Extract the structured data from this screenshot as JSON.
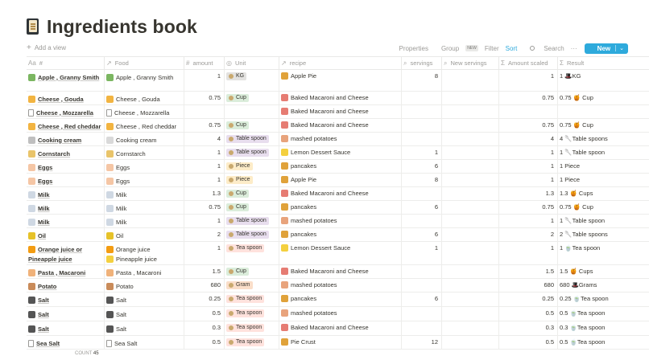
{
  "page": {
    "title": "Ingredients book",
    "icon": "book-icon"
  },
  "toolbar": {
    "add_view": "Add a view",
    "properties": "Properties",
    "group": "Group",
    "group_badge": "NEW",
    "filter": "Filter",
    "sort": "Sort",
    "search": "Search",
    "more": "···",
    "new": "New",
    "new_caret": "⌄"
  },
  "columns": [
    {
      "label": "#",
      "icon": "Aa"
    },
    {
      "label": "Food",
      "icon": "↗"
    },
    {
      "label": "amount",
      "icon": "#"
    },
    {
      "label": "Unit",
      "icon": "◎"
    },
    {
      "label": "recipe",
      "icon": "↗"
    },
    {
      "label": "servings",
      "icon": "⌕"
    },
    {
      "label": "New servings",
      "icon": "⌕"
    },
    {
      "label": "Amount scaled",
      "icon": "Σ"
    },
    {
      "label": "Result",
      "icon": "Σ"
    }
  ],
  "tag_colors": {
    "KG": "#e3e2e0",
    "Cup": "#dbeddb",
    "Table spoon": "#e8deee",
    "Piece": "#fdecc8",
    "Tea spoon": "#ffe2dd",
    "Gram": "#fadec9"
  },
  "rows": [
    {
      "name": [
        "Apple , Granny Smith"
      ],
      "icon": "#7bb661",
      "food": [
        "Apple , Granny Smith"
      ],
      "food_icon": "#7bb661",
      "amount": "1",
      "unit": "KG",
      "recipe": "Apple Pie",
      "recipe_icon": "#e0a23a",
      "servings": "8",
      "new_servings": "",
      "scaled": "1",
      "result": "1 🎩KG",
      "h": 27
    },
    {
      "name": [
        "Cheese , Gouda"
      ],
      "icon": "#f2b441",
      "food": [
        "Cheese , Gouda"
      ],
      "food_icon": "#f2b441",
      "amount": "0.75",
      "unit": "Cup",
      "recipe": "Baked Macaroni and Cheese",
      "recipe_icon": "#e67c73",
      "servings": "",
      "new_servings": "",
      "scaled": "0.75",
      "result": "0.75 🍯 Cup",
      "h": 17
    },
    {
      "name": [
        "Cheese , Mozzarella"
      ],
      "icon": "page",
      "food": [
        "Cheese , Mozzarella"
      ],
      "food_icon": "page",
      "amount": "",
      "unit": "",
      "recipe": "Baked Macaroni and Cheese",
      "recipe_icon": "#e67c73",
      "servings": "",
      "new_servings": "",
      "scaled": "",
      "result": "",
      "h": 17
    },
    {
      "name": [
        "Cheese , Red cheddar"
      ],
      "icon": "#f2b441",
      "food": [
        "Cheese , Red cheddar"
      ],
      "food_icon": "#f2b441",
      "amount": "0.75",
      "unit": "Cup",
      "recipe": "Baked Macaroni and Cheese",
      "recipe_icon": "#e67c73",
      "servings": "",
      "new_servings": "",
      "scaled": "0.75",
      "result": "0.75 🍯 Cup",
      "h": 17
    },
    {
      "name": [
        "Cooking cream"
      ],
      "icon": "#bfbfbf",
      "food": [
        "Cooking cream"
      ],
      "food_icon": "#d9d9d9",
      "amount": "4",
      "unit": "Table spoon",
      "recipe": "mashed potatoes",
      "recipe_icon": "#e8a37c",
      "servings": "",
      "new_servings": "",
      "scaled": "4",
      "result": "4 🥄Table spoons",
      "h": 17
    },
    {
      "name": [
        "Cornstarch"
      ],
      "icon": "#e9c46a",
      "food": [
        "Cornstarch"
      ],
      "food_icon": "#e9c46a",
      "amount": "1",
      "unit": "Table spoon",
      "recipe": "Lemon Dessert Sauce",
      "recipe_icon": "#f4d03f",
      "servings": "1",
      "new_servings": "",
      "scaled": "1",
      "result": "1 🥄Table spoon",
      "h": 17
    },
    {
      "name": [
        "Eggs"
      ],
      "icon": "#f5c6a5",
      "food": [
        "Eggs"
      ],
      "food_icon": "#f5c6a5",
      "amount": "1",
      "unit": "Piece",
      "recipe": "pancakes",
      "recipe_icon": "#e0a23a",
      "servings": "6",
      "new_servings": "",
      "scaled": "1",
      "result": "1 Piece",
      "h": 17
    },
    {
      "name": [
        "Eggs"
      ],
      "icon": "#f5c6a5",
      "food": [
        "Eggs"
      ],
      "food_icon": "#f5c6a5",
      "amount": "1",
      "unit": "Piece",
      "recipe": "Apple Pie",
      "recipe_icon": "#e0a23a",
      "servings": "8",
      "new_servings": "",
      "scaled": "1",
      "result": "1 Piece",
      "h": 17
    },
    {
      "name": [
        "Milk"
      ],
      "icon": "#cfd8e3",
      "food": [
        "Milk"
      ],
      "food_icon": "#cfd8e3",
      "amount": "1.3",
      "unit": "Cup",
      "recipe": "Baked Macaroni and Cheese",
      "recipe_icon": "#e67c73",
      "servings": "",
      "new_servings": "",
      "scaled": "1.3",
      "result": "1.3 🍯 Cups",
      "h": 17
    },
    {
      "name": [
        "Milk"
      ],
      "icon": "#cfd8e3",
      "food": [
        "Milk"
      ],
      "food_icon": "#cfd8e3",
      "amount": "0.75",
      "unit": "Cup",
      "recipe": "pancakes",
      "recipe_icon": "#e0a23a",
      "servings": "6",
      "new_servings": "",
      "scaled": "0.75",
      "result": "0.75 🍯 Cup",
      "h": 17
    },
    {
      "name": [
        "Milk"
      ],
      "icon": "#cfd8e3",
      "food": [
        "Milk"
      ],
      "food_icon": "#cfd8e3",
      "amount": "1",
      "unit": "Table spoon",
      "recipe": "mashed potatoes",
      "recipe_icon": "#e8a37c",
      "servings": "",
      "new_servings": "",
      "scaled": "1",
      "result": "1 🥄Table spoon",
      "h": 17
    },
    {
      "name": [
        "Oil"
      ],
      "icon": "#e6c229",
      "food": [
        "Oil"
      ],
      "food_icon": "#e6c229",
      "amount": "2",
      "unit": "Table spoon",
      "recipe": "pancakes",
      "recipe_icon": "#e0a23a",
      "servings": "6",
      "new_servings": "",
      "scaled": "2",
      "result": "2 🥄Table spoons",
      "h": 17
    },
    {
      "name": [
        "Orange juice or",
        "Pineapple juice"
      ],
      "icon": "#f39c12",
      "food": [
        "Orange juice",
        "Pineapple juice"
      ],
      "food_icon": "#f39c12",
      "amount": "1",
      "unit": "Tea spoon",
      "recipe": "Lemon Dessert Sauce",
      "recipe_icon": "#f4d03f",
      "servings": "1",
      "new_servings": "",
      "scaled": "1",
      "result": "1 🍵Tea spoon",
      "h": 29
    },
    {
      "name": [
        "Pasta , Macaroni"
      ],
      "icon": "#f0b27a",
      "food": [
        "Pasta , Macaroni"
      ],
      "food_icon": "#f0b27a",
      "amount": "1.5",
      "unit": "Cup",
      "recipe": "Baked Macaroni and Cheese",
      "recipe_icon": "#e67c73",
      "servings": "",
      "new_servings": "",
      "scaled": "1.5",
      "result": "1.5 🍯 Cups",
      "h": 17
    },
    {
      "name": [
        "Potato"
      ],
      "icon": "#c98b5a",
      "food": [
        "Potato"
      ],
      "food_icon": "#c98b5a",
      "amount": "680",
      "unit": "Gram",
      "recipe": "mashed potatoes",
      "recipe_icon": "#e8a37c",
      "servings": "",
      "new_servings": "",
      "scaled": "680",
      "result": "680 🎩Grams",
      "h": 17
    },
    {
      "name": [
        "Salt"
      ],
      "icon": "#555555",
      "food": [
        "Salt"
      ],
      "food_icon": "#555555",
      "amount": "0.25",
      "unit": "Tea spoon",
      "recipe": "pancakes",
      "recipe_icon": "#e0a23a",
      "servings": "6",
      "new_servings": "",
      "scaled": "0.25",
      "result": "0.25 🍵Tea spoon",
      "h": 18
    },
    {
      "name": [
        "Salt"
      ],
      "icon": "#555555",
      "food": [
        "Salt"
      ],
      "food_icon": "#555555",
      "amount": "0.5",
      "unit": "Tea spoon",
      "recipe": "mashed potatoes",
      "recipe_icon": "#e8a37c",
      "servings": "",
      "new_servings": "",
      "scaled": "0.5",
      "result": "0.5 🍵Tea spoon",
      "h": 18
    },
    {
      "name": [
        "Salt"
      ],
      "icon": "#555555",
      "food": [
        "Salt"
      ],
      "food_icon": "#555555",
      "amount": "0.3",
      "unit": "Tea spoon",
      "recipe": "Baked Macaroni and Cheese",
      "recipe_icon": "#e67c73",
      "servings": "",
      "new_servings": "",
      "scaled": "0.3",
      "result": "0.3 🍵Tea spoon",
      "h": 18
    },
    {
      "name": [
        "Sea Salt"
      ],
      "icon": "page",
      "food": [
        "Sea Salt"
      ],
      "food_icon": "page",
      "amount": "0.5",
      "unit": "Tea spoon",
      "recipe": "Pie Crust",
      "recipe_icon": "#e0a23a",
      "servings": "12",
      "new_servings": "",
      "scaled": "0.5",
      "result": "0.5 🍵Tea spoon",
      "h": 17
    }
  ],
  "footer": {
    "count_label": "COUNT",
    "count_value": "45"
  }
}
